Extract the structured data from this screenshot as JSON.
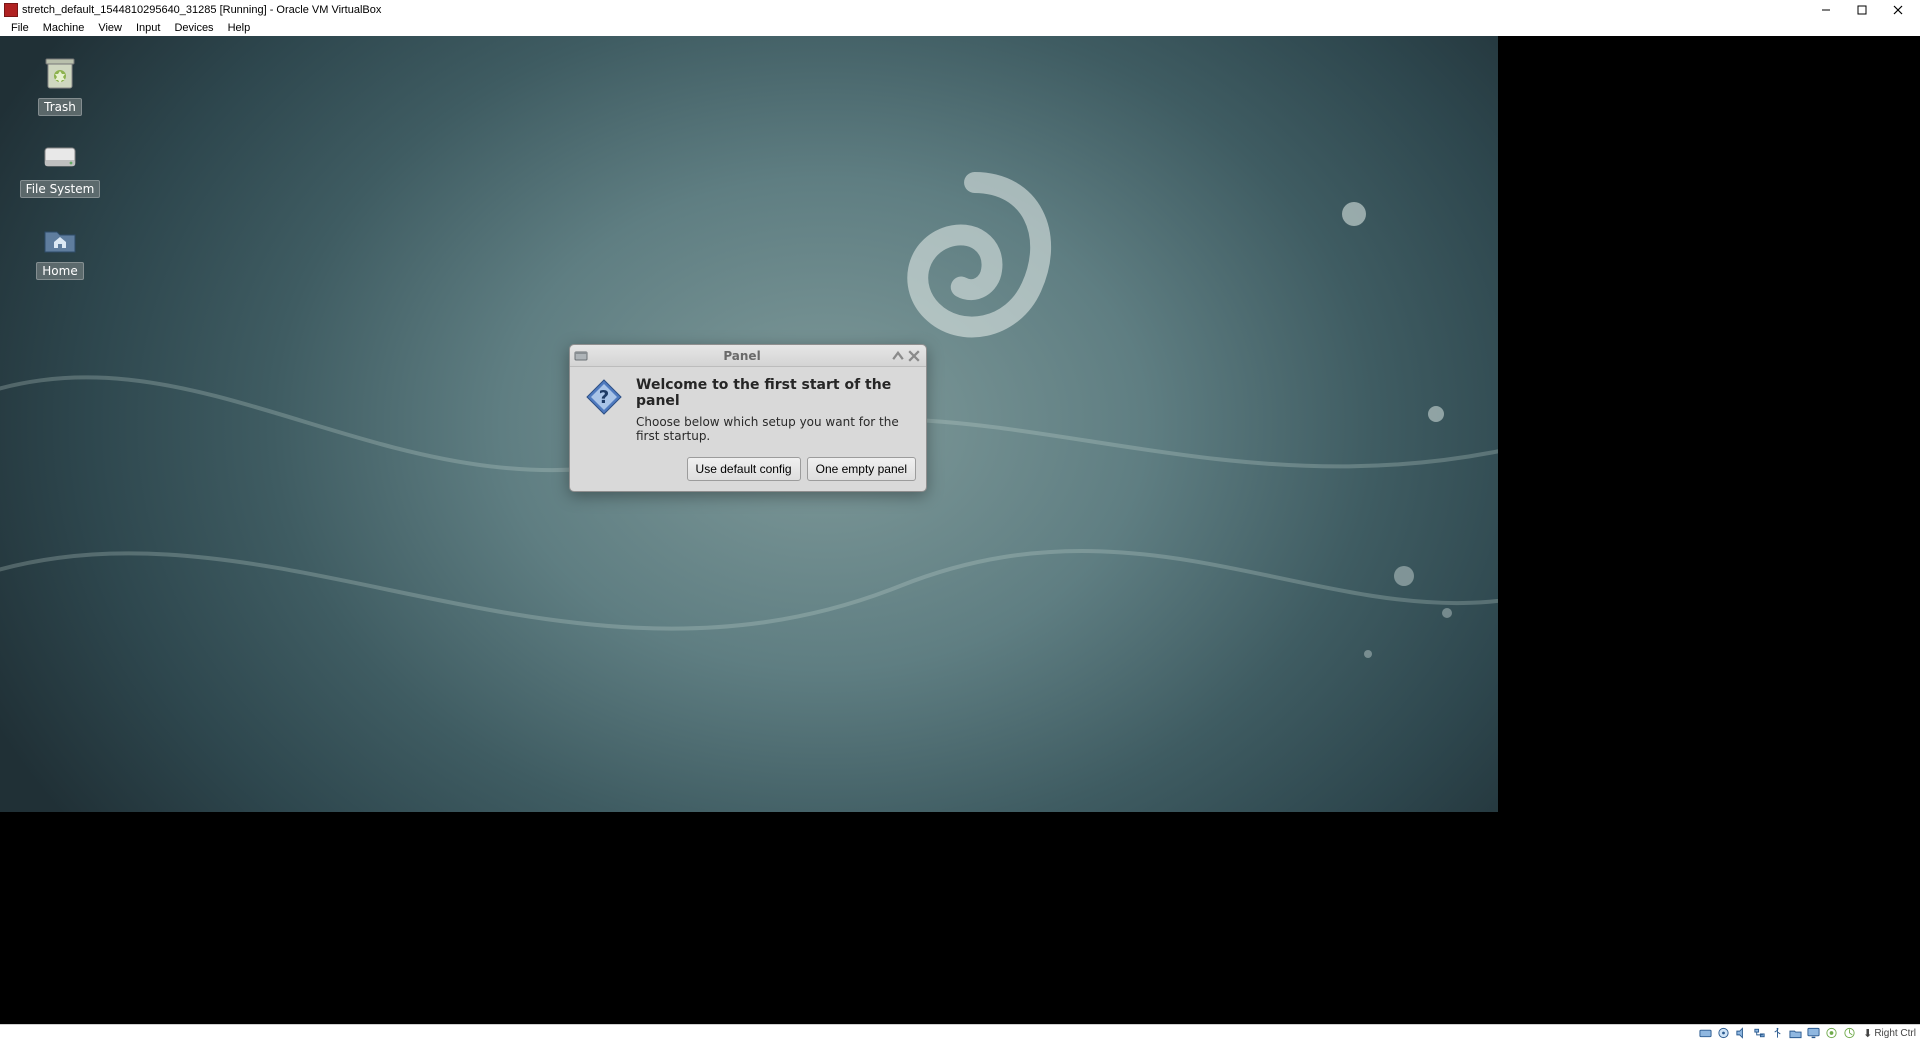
{
  "window": {
    "title": "stretch_default_1544810295640_31285 [Running] - Oracle VM VirtualBox"
  },
  "menubar": {
    "items": [
      "File",
      "Machine",
      "View",
      "Input",
      "Devices",
      "Help"
    ]
  },
  "desktop_icons": {
    "trash": "Trash",
    "filesystem": "File System",
    "home": "Home"
  },
  "dialog": {
    "title": "Panel",
    "heading": "Welcome to the first start of the panel",
    "message": "Choose below which setup you want for the first startup.",
    "btn_default": "Use default config",
    "btn_empty": "One empty panel"
  },
  "statusbar": {
    "hostkey": "Right Ctrl"
  }
}
